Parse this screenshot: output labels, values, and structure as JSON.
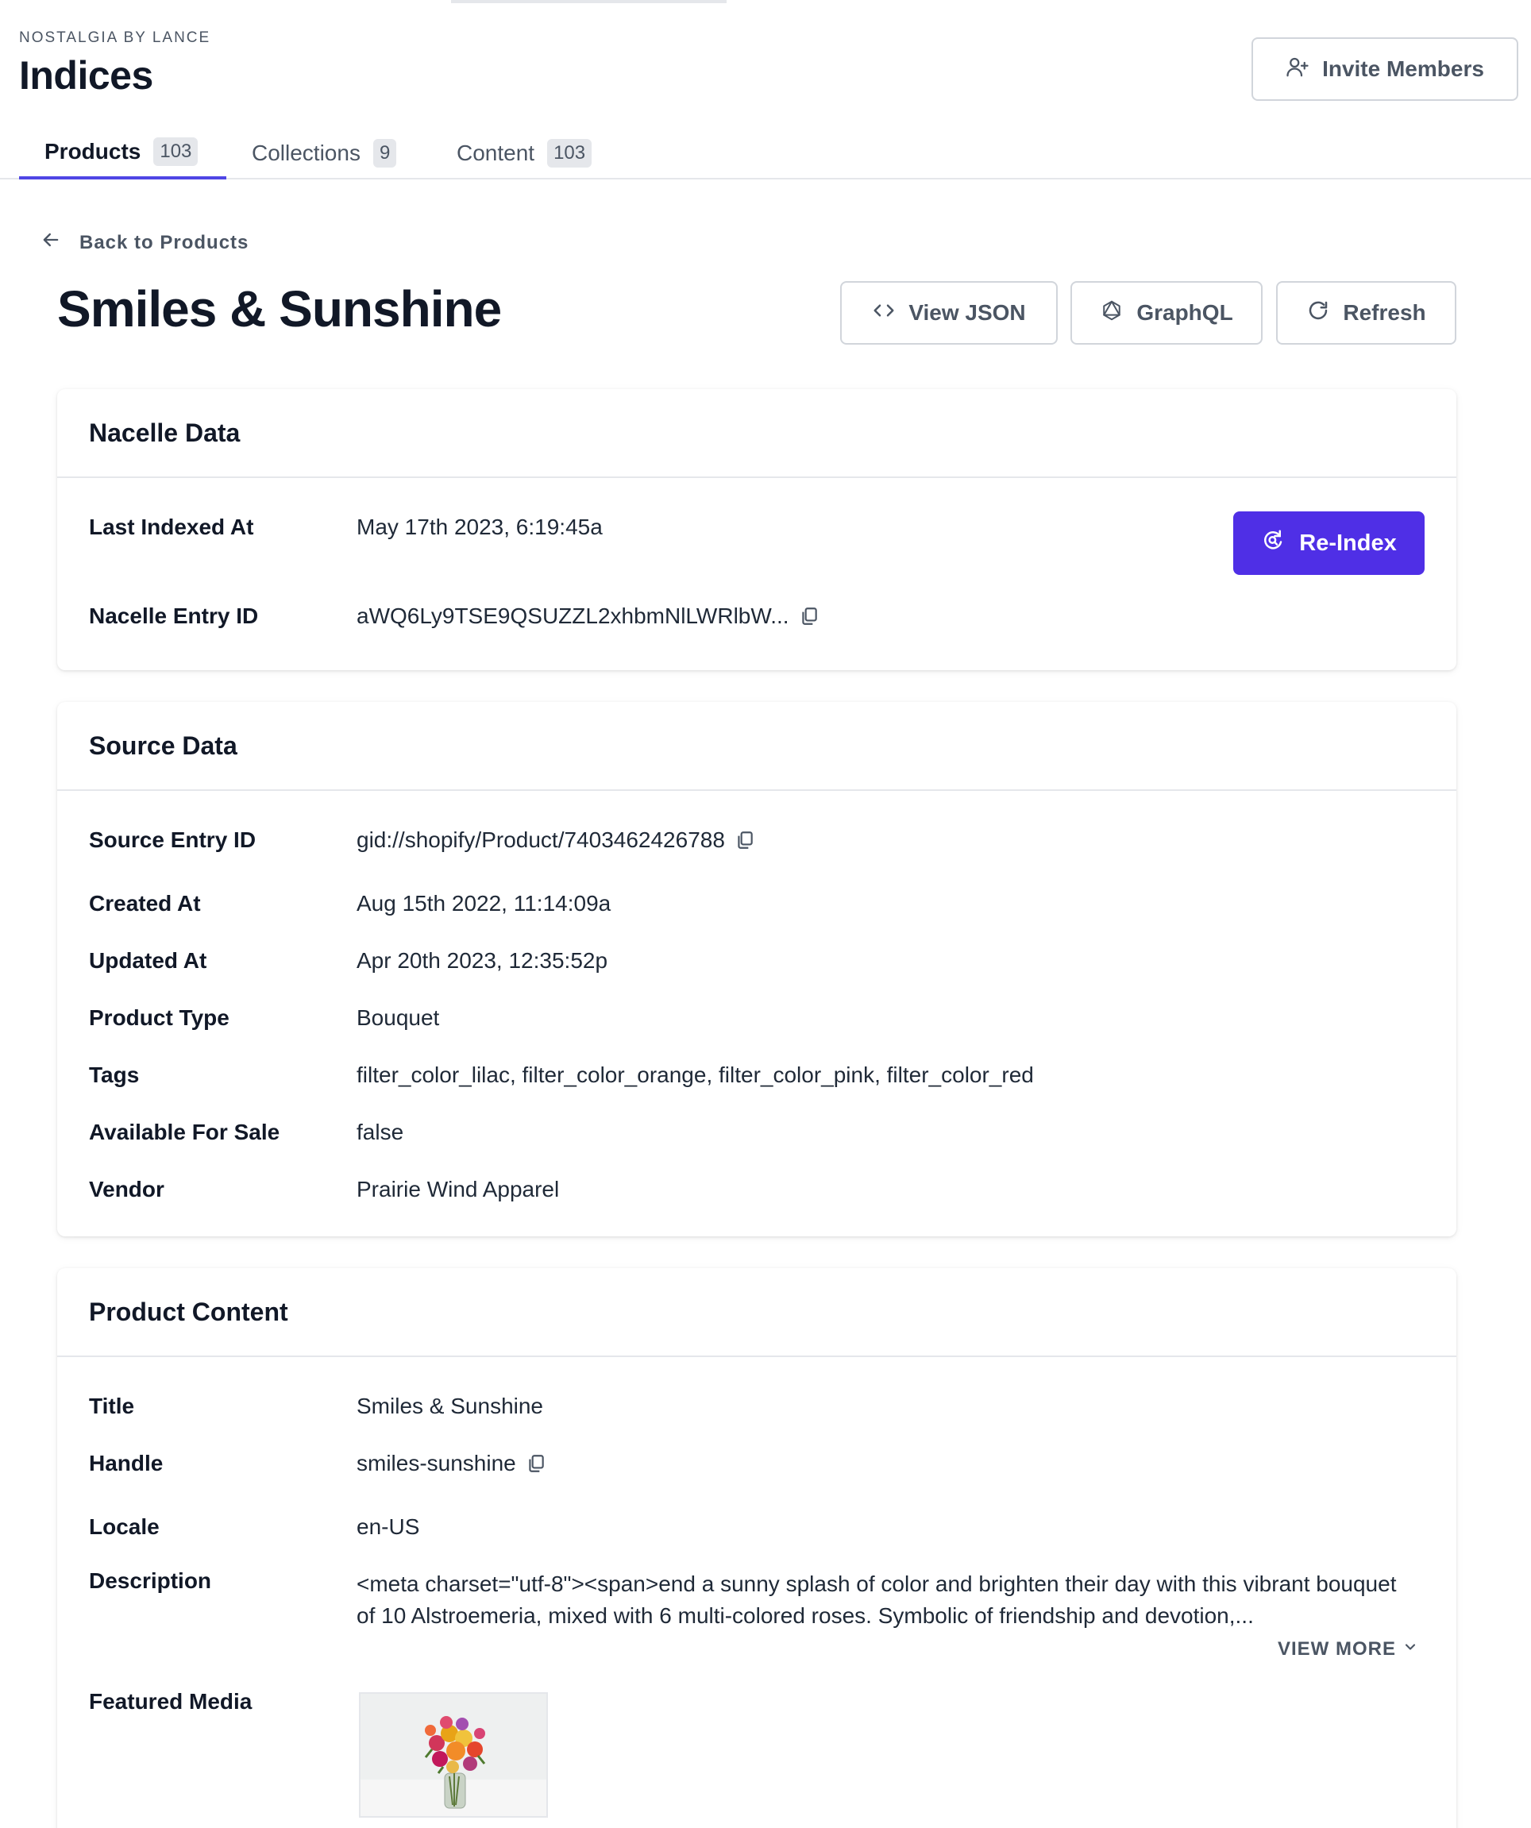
{
  "header": {
    "org": "NOSTALGIA BY LANCE",
    "title": "Indices",
    "invite_label": "Invite Members"
  },
  "tabs": [
    {
      "label": "Products",
      "count": "103",
      "active": true
    },
    {
      "label": "Collections",
      "count": "9",
      "active": false
    },
    {
      "label": "Content",
      "count": "103",
      "active": false
    }
  ],
  "back_label": "Back to Products",
  "product": {
    "title": "Smiles & Sunshine",
    "actions": {
      "view_json": "View JSON",
      "graphql": "GraphQL",
      "refresh": "Refresh"
    }
  },
  "nacelle": {
    "heading": "Nacelle Data",
    "reindex_label": "Re-Index",
    "rows": [
      {
        "label": "Last Indexed At",
        "value": "May 17th 2023, 6:19:45a"
      },
      {
        "label": "Nacelle Entry ID",
        "value": "aWQ6Ly9TSE9QSUZZL2xhbmNlLWRlbW..."
      }
    ]
  },
  "source": {
    "heading": "Source Data",
    "rows": [
      {
        "label": "Source Entry ID",
        "value": "gid://shopify/Product/7403462426788"
      },
      {
        "label": "Created At",
        "value": "Aug 15th 2022, 11:14:09a"
      },
      {
        "label": "Updated At",
        "value": "Apr 20th 2023, 12:35:52p"
      },
      {
        "label": "Product Type",
        "value": "Bouquet"
      },
      {
        "label": "Tags",
        "value": "filter_color_lilac, filter_color_orange, filter_color_pink, filter_color_red"
      },
      {
        "label": "Available For Sale",
        "value": "false"
      },
      {
        "label": "Vendor",
        "value": "Prairie Wind Apparel"
      }
    ]
  },
  "content": {
    "heading": "Product Content",
    "rows": [
      {
        "label": "Title",
        "value": "Smiles & Sunshine"
      },
      {
        "label": "Handle",
        "value": "smiles-sunshine"
      },
      {
        "label": "Locale",
        "value": "en-US"
      },
      {
        "label": "Description",
        "value": "<meta charset=\"utf-8\"><span>end a sunny splash of color and brighten their day with this vibrant bouquet of 10 Alstroemeria, mixed with 6 multi-colored roses. Symbolic of friendship and devotion,..."
      },
      {
        "label": "Featured Media",
        "value": ""
      }
    ],
    "view_more": "VIEW MORE"
  },
  "colors": {
    "accent": "#4f2fe6",
    "tab_underline": "#4f46e5"
  }
}
